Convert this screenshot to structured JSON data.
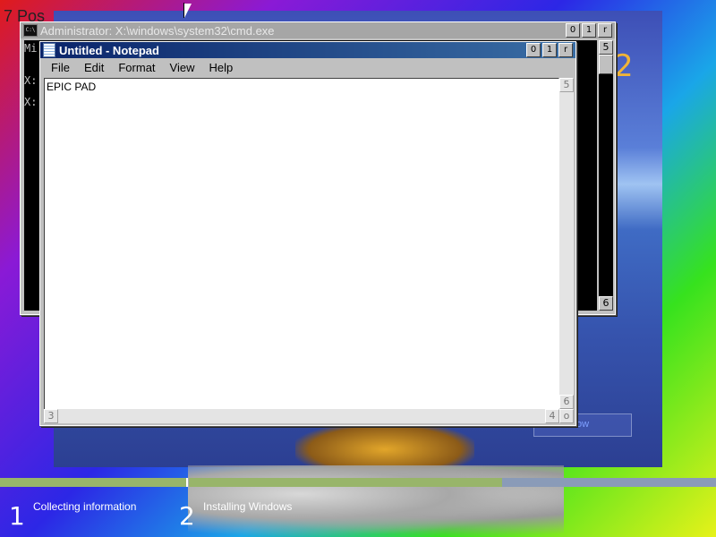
{
  "background": {
    "corner_text": "7 Pos",
    "big_number": "2",
    "ghost_button_text": "…ow"
  },
  "cmd": {
    "title": "Administrator: X:\\windows\\system32\\cmd.exe",
    "icon_text": "C:\\",
    "buttons": [
      "0",
      "1",
      "r"
    ],
    "lines": [
      "Mi",
      "X:",
      "X:"
    ],
    "scroll_up": "5",
    "scroll_down": "6"
  },
  "notepad": {
    "title": "Untitled - Notepad",
    "buttons": [
      "0",
      "1",
      "r"
    ],
    "menu": [
      "File",
      "Edit",
      "Format",
      "View",
      "Help"
    ],
    "content": "EPIC PAD",
    "v_scroll_up": "5",
    "v_scroll_down": "6",
    "h_scroll_left": "3",
    "h_scroll_right": "4",
    "size_grip": "o"
  },
  "setup": {
    "steps": [
      {
        "number": "1",
        "label": "Collecting information"
      },
      {
        "number": "2",
        "label": "Installing Windows"
      }
    ],
    "colors": {
      "done": "#98b56a",
      "pending": "#8a9bb8"
    }
  }
}
